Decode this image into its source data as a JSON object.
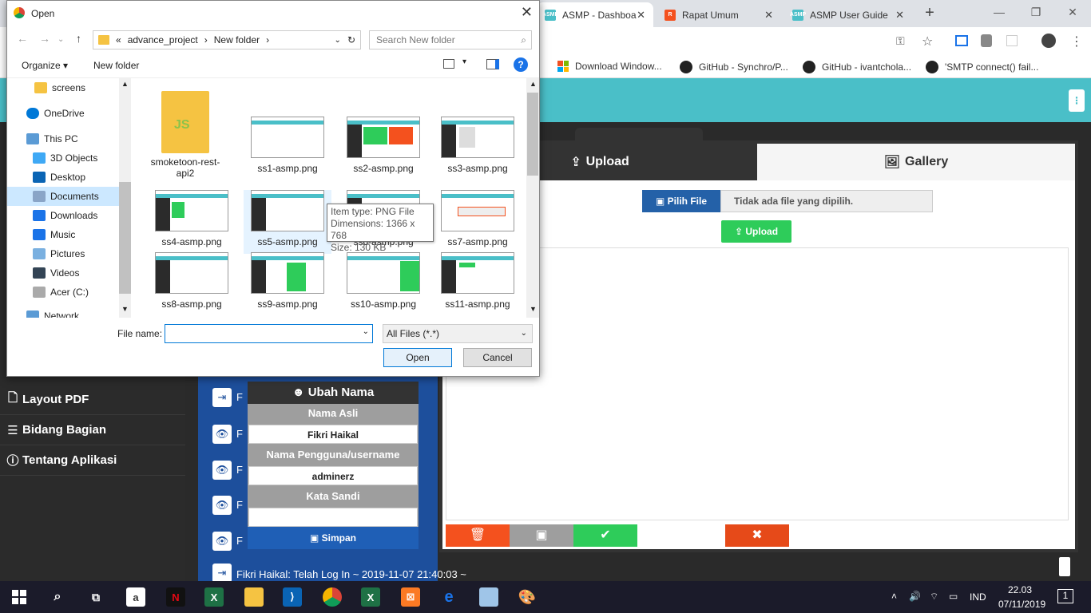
{
  "browser": {
    "tabs": [
      {
        "label": "ASMP - Dashboard",
        "favicon": "ASMP",
        "active": true
      },
      {
        "label": "Rapat Umum",
        "favicon": "R",
        "active": false
      },
      {
        "label": "ASMP User Guide",
        "favicon": "ASMP",
        "active": false
      }
    ],
    "bookmarks": [
      {
        "label": "Download Window...",
        "icon": "microsoft-icon"
      },
      {
        "label": "GitHub - Synchro/P...",
        "icon": "github-icon"
      },
      {
        "label": "GitHub - ivantchola...",
        "icon": "github-icon"
      },
      {
        "label": "'SMTP connect() fail...",
        "icon": "github-icon"
      }
    ]
  },
  "page": {
    "sidebar": [
      {
        "label": "Layout PDF",
        "icon": "file-icon"
      },
      {
        "label": "Bidang Bagian",
        "icon": "list-icon"
      },
      {
        "label": "Tentang Aplikasi",
        "icon": "info-icon"
      }
    ],
    "log_row_letter": "F",
    "log_line": "Fikri Haikal: Telah Log In ~ 2019-11-07 21:40:03 ~",
    "ubah_nama": {
      "title": "Ubah Nama",
      "nama_asli_label": "Nama Asli",
      "nama_asli_value": "Fikri Haikal",
      "username_label": "Nama Pengguna/username",
      "username_value": "adminerz",
      "password_label": "Kata Sandi",
      "password_value": "",
      "save_label": "Simpan"
    },
    "upload_panel": {
      "tab_upload": "Upload",
      "tab_gallery": "Gallery",
      "pilih_file": "Pilih File",
      "no_file_text": "Tidak ada file yang dipilih.",
      "upload_btn": "Upload"
    }
  },
  "dialog": {
    "title": "Open",
    "path_prefix": "«",
    "path": [
      "advance_project",
      "New folder"
    ],
    "search_placeholder": "Search New folder",
    "organize": "Organize ▾",
    "new_folder": "New folder",
    "nav_items": [
      {
        "label": "screens",
        "icon": "folder-icon"
      },
      {
        "label": "OneDrive",
        "icon": "cloud-icon"
      },
      {
        "label": "This PC",
        "icon": "pc-icon"
      },
      {
        "label": "3D Objects",
        "icon": "cube-icon"
      },
      {
        "label": "Desktop",
        "icon": "desktop-icon"
      },
      {
        "label": "Documents",
        "icon": "documents-icon"
      },
      {
        "label": "Downloads",
        "icon": "download-icon"
      },
      {
        "label": "Music",
        "icon": "music-icon"
      },
      {
        "label": "Pictures",
        "icon": "pictures-icon"
      },
      {
        "label": "Videos",
        "icon": "videos-icon"
      },
      {
        "label": "Acer (C:)",
        "icon": "drive-icon"
      },
      {
        "label": "Network",
        "icon": "network-icon"
      }
    ],
    "files": [
      {
        "name": "smoketoon-rest-api2",
        "kind": "folder"
      },
      {
        "name": "ss1-asmp.png",
        "kind": "image"
      },
      {
        "name": "ss2-asmp.png",
        "kind": "image"
      },
      {
        "name": "ss3-asmp.png",
        "kind": "image"
      },
      {
        "name": "ss4-asmp.png",
        "kind": "image"
      },
      {
        "name": "ss5-asmp.png",
        "kind": "image"
      },
      {
        "name": "ss6-asmp.png",
        "kind": "image"
      },
      {
        "name": "ss7-asmp.png",
        "kind": "image"
      },
      {
        "name": "ss8-asmp.png",
        "kind": "image"
      },
      {
        "name": "ss9-asmp.png",
        "kind": "image"
      },
      {
        "name": "ss10-asmp.png",
        "kind": "image"
      },
      {
        "name": "ss11-asmp.png",
        "kind": "image"
      }
    ],
    "tooltip": {
      "line1": "Item type: PNG File",
      "line2": "Dimensions: 1366 x 768",
      "line3": "Size: 130 KB"
    },
    "file_name_label": "File name:",
    "file_name_value": "",
    "file_type": "All Files (*.*)",
    "open_label": "Open",
    "cancel_label": "Cancel"
  },
  "taskbar": {
    "language": "IND",
    "time": "22.03",
    "date": "07/11/2019",
    "notifications": "1"
  },
  "colors": {
    "header_teal": "#4abfc8",
    "sidebar_dark": "#2b2b2b",
    "upload_blue": "#2461a8",
    "upload_green": "#2ecc5a",
    "delete_red": "#f4511e"
  }
}
